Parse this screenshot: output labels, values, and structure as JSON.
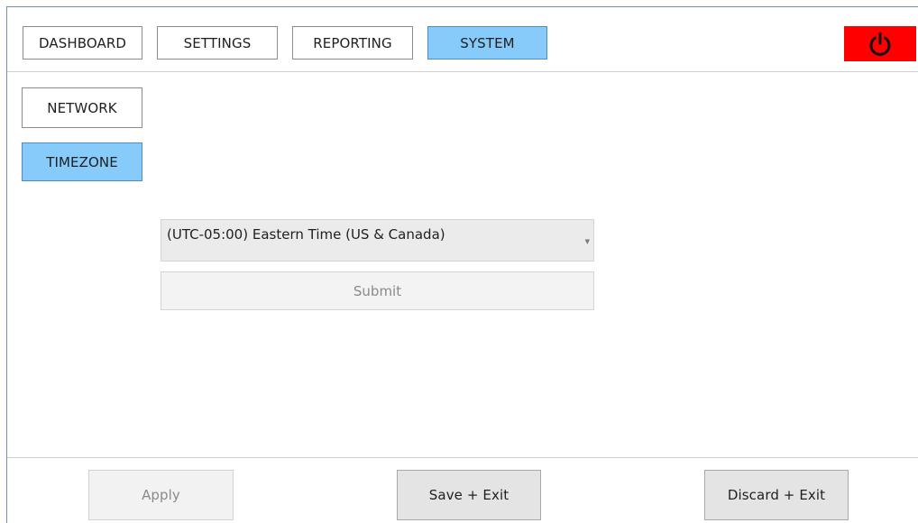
{
  "topnav": {
    "tabs": [
      {
        "label": "DASHBOARD"
      },
      {
        "label": "SETTINGS"
      },
      {
        "label": "REPORTING"
      },
      {
        "label": "SYSTEM"
      }
    ],
    "active_tab": "SYSTEM",
    "power_icon": "power-icon",
    "power_color": "#ff0000"
  },
  "sidenav": {
    "items": [
      {
        "label": "NETWORK"
      },
      {
        "label": "TIMEZONE"
      }
    ],
    "active_item": "TIMEZONE"
  },
  "timezone": {
    "selected": "(UTC-05:00) Eastern Time (US & Canada)",
    "dropdown_icon": "chevron-down-icon",
    "submit_label": "Submit"
  },
  "footer": {
    "apply_label": "Apply",
    "save_label": "Save + Exit",
    "discard_label": "Discard + Exit"
  },
  "colors": {
    "active": "#86cbf9",
    "power": "#ff0000"
  }
}
